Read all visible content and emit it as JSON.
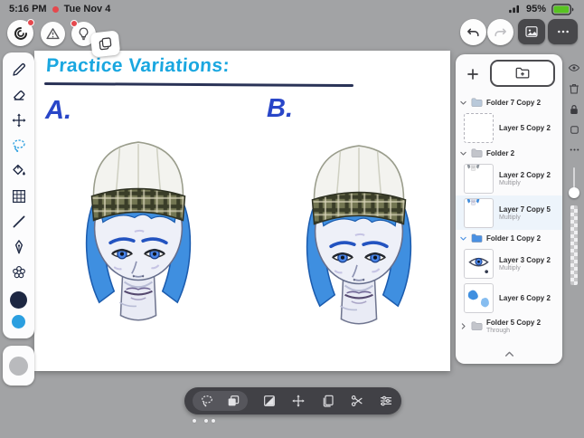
{
  "status_bar": {
    "time": "5:16 PM",
    "date": "Tue Nov 4",
    "battery_percent": "95%",
    "icons": [
      "recording-dot",
      "signal-icon",
      "battery-icon"
    ]
  },
  "top_toolbar": {
    "left_icons": [
      "brush-logo-icon",
      "warning-icon",
      "lightbulb-icon",
      "duplicate-icon"
    ],
    "badges": [
      "red-dot-on-logo",
      "red-dot-on-lightbulb"
    ],
    "right_icons": [
      "undo-icon",
      "redo-icon",
      "image-library-icon",
      "more-options-icon"
    ]
  },
  "left_toolbar": {
    "tools": [
      "brush",
      "eraser",
      "transform",
      "lasso-select",
      "fill",
      "grid",
      "line",
      "pen",
      "shapes"
    ],
    "active_tool": "lasso-select",
    "color_swatches": [
      "#1d2742",
      "#2b9fe0"
    ],
    "reference_swatch": "#b9babd"
  },
  "canvas": {
    "title": "Practice Variations:",
    "label_a": "A.",
    "label_b": "B."
  },
  "layers_panel": {
    "buttons": [
      "add-layer",
      "add-folder"
    ],
    "rows": [
      {
        "type": "folder",
        "name": "Folder 7 Copy 2",
        "blend": "",
        "expanded": true
      },
      {
        "type": "layer",
        "name": "Layer 5 Copy 2",
        "blend": ""
      },
      {
        "type": "folder",
        "name": "Folder 2",
        "blend": "",
        "expanded": true
      },
      {
        "type": "layer",
        "name": "Layer 2 Copy 2",
        "blend": "Multiply"
      },
      {
        "type": "layer",
        "name": "Layer 7 Copy 5",
        "blend": "Multiply"
      },
      {
        "type": "folder",
        "name": "Folder 1 Copy 2",
        "blend": "",
        "expanded": true
      },
      {
        "type": "layer",
        "name": "Layer 3 Copy 2",
        "blend": "Multiply"
      },
      {
        "type": "layer",
        "name": "Layer 6 Copy 2",
        "blend": ""
      },
      {
        "type": "folder",
        "name": "Folder 5 Copy 2",
        "blend": "Through",
        "expanded": false
      }
    ]
  },
  "right_strip": {
    "icons": [
      "eye-icon",
      "trash-icon",
      "lock-icon",
      "layer-box-icon",
      "more-dots-icon"
    ],
    "slider": "opacity-slider"
  },
  "bottom_toolbar": {
    "icons": [
      "lasso-icon",
      "duplicate-icon",
      "gradient-icon",
      "move-icon",
      "copy-icon",
      "scissors-icon",
      "adjust-icon"
    ],
    "page_dots": 3
  },
  "colors": {
    "background": "#a2a3a5",
    "accent_blue": "#2b9fe0",
    "title_blue": "#1aa7e0",
    "label_blue": "#2946c8",
    "folder_blue": "#4a90e2",
    "dark_button": "#48484b",
    "underline_navy": "#2a3357"
  }
}
